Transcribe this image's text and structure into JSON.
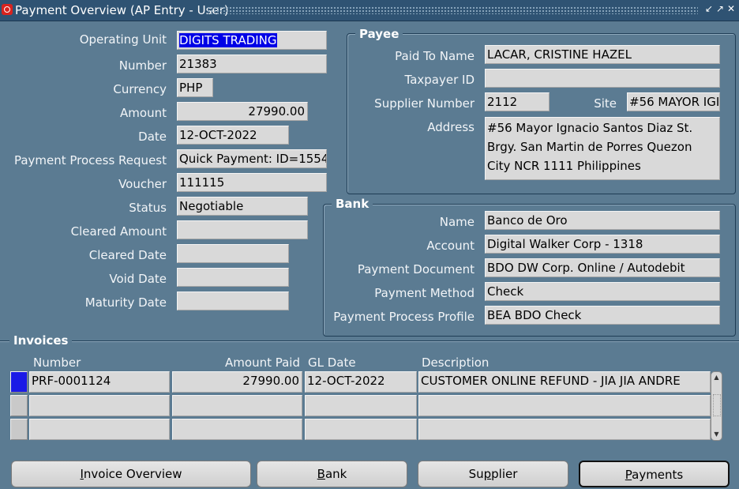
{
  "window": {
    "title": "Payment Overview (AP Entry - User)"
  },
  "payment": {
    "operating_unit_label": "Operating Unit",
    "operating_unit": "DIGITS TRADING",
    "number_label": "Number",
    "number": "21383",
    "currency_label": "Currency",
    "currency": "PHP",
    "amount_label": "Amount",
    "amount": "27990.00",
    "date_label": "Date",
    "date": "12-OCT-2022",
    "ppr_label": "Payment Process Request",
    "ppr": "Quick Payment: ID=1554",
    "voucher_label": "Voucher",
    "voucher": "111115",
    "status_label": "Status",
    "status": "Negotiable",
    "cleared_amount_label": "Cleared Amount",
    "cleared_amount": "",
    "cleared_date_label": "Cleared Date",
    "cleared_date": "",
    "void_date_label": "Void Date",
    "void_date": "",
    "maturity_date_label": "Maturity Date",
    "maturity_date": ""
  },
  "payee": {
    "title": "Payee",
    "paid_to_name_label": "Paid To Name",
    "paid_to_name": "LACAR, CRISTINE HAZEL",
    "taxpayer_id_label": "Taxpayer ID",
    "taxpayer_id": "",
    "supplier_number_label": "Supplier Number",
    "supplier_number": "2112",
    "site_label": "Site",
    "site": "#56 MAYOR IGI",
    "address_label": "Address",
    "address": "#56 Mayor Ignacio Santos Diaz St. Brgy. San Martin de Porres Quezon City NCR 1111 Philippines"
  },
  "bank": {
    "title": "Bank",
    "name_label": "Name",
    "name": "Banco de Oro",
    "account_label": "Account",
    "account": "Digital Walker Corp - 1318",
    "payment_document_label": "Payment Document",
    "payment_document": "BDO DW Corp. Online / Autodebit",
    "payment_method_label": "Payment Method",
    "payment_method": "Check",
    "payment_process_profile_label": "Payment Process Profile",
    "payment_process_profile": "BEA BDO Check"
  },
  "invoices": {
    "title": "Invoices",
    "columns": [
      "Number",
      "Amount Paid",
      "GL Date",
      "Description"
    ],
    "rows": [
      {
        "number": "PRF-0001124",
        "amount_paid": "27990.00",
        "gl_date": "12-OCT-2022",
        "description": "CUSTOMER ONLINE REFUND - JIA JIA ANDRE"
      },
      {
        "number": "",
        "amount_paid": "",
        "gl_date": "",
        "description": ""
      },
      {
        "number": "",
        "amount_paid": "",
        "gl_date": "",
        "description": ""
      }
    ]
  },
  "buttons": {
    "invoice_overview": {
      "pre": "",
      "key": "I",
      "post": "nvoice Overview"
    },
    "bank": {
      "pre": "",
      "key": "B",
      "post": "ank"
    },
    "supplier": {
      "pre": "Su",
      "key": "p",
      "post": "plier"
    },
    "payments": {
      "pre": "",
      "key": "P",
      "post": "ayments"
    }
  }
}
